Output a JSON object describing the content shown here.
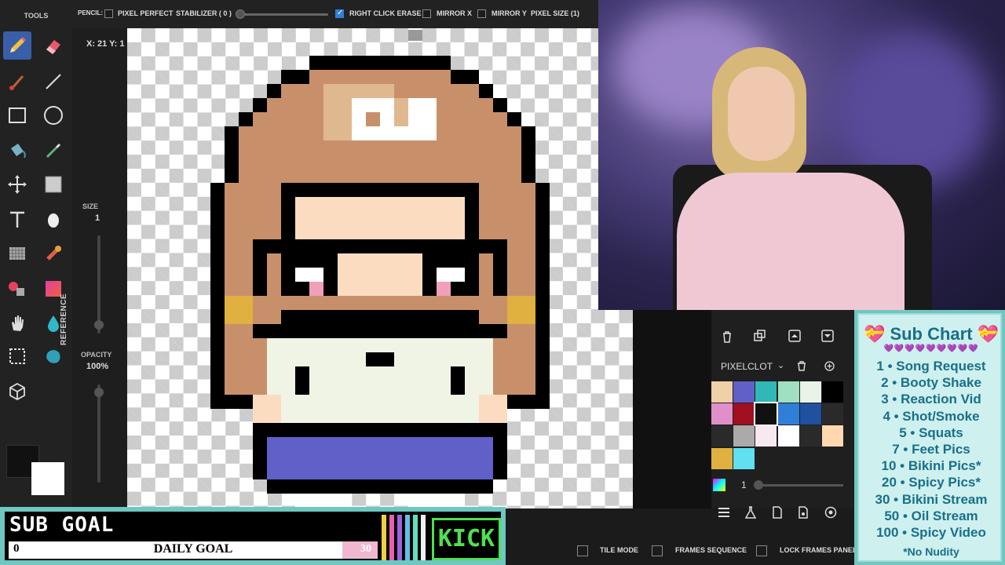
{
  "toolbar": {
    "tools_title": "TOOLS",
    "pencil_label": "PENCIL:",
    "pixel_perfect": "PIXEL PERFECT",
    "stabilizer": "STABILIZER ( 0 )",
    "right_click_erase": "RIGHT CLICK ERASE",
    "mirror_x": "MIRROR X",
    "mirror_y": "MIRROR Y",
    "pixel_size": "PIXEL SIZE (1)"
  },
  "coordinates": "X: 21 Y: 1",
  "left_panel": {
    "size_label": "SIZE",
    "size_value": "1",
    "opacity_label": "OPACITY",
    "opacity_value": "100%"
  },
  "right_panel": {
    "reference_label": "REFERENCE",
    "palette_name": "PIXELCLOT"
  },
  "palette": {
    "colors": [
      "#f0d0a8",
      "#6060c8",
      "#30b8b8",
      "#a0e0c0",
      "#e8f4e8",
      "#000000",
      "#e090c8",
      "#a01020",
      "#111111",
      "#2f7fd8",
      "#2050a0",
      "#2a2a2a",
      "#2a2a2a",
      "#aaaaaa",
      "#f8e8f0",
      "#ffffff",
      "#2a2a2a",
      "#ffd8b0",
      "#e0b040",
      "#60e0f0"
    ],
    "layers_count": "1"
  },
  "bottom_bar": {
    "tile_mode": "TILE MODE",
    "frames_sequence": "FRAMES SEQUENCE",
    "lock_frames_panel": "LOCK FRAMES PANEL"
  },
  "sub_goal": {
    "title": "SUB GOAL",
    "start": "0",
    "label": "DAILY GOAL",
    "end": "30",
    "kick": "KICK",
    "progress_percent": 10
  },
  "sub_chart": {
    "title": "💝 Sub Chart 💝",
    "hearts": "💜💜💜💜💜💜💜💜💜",
    "items": [
      "1 • Song Request",
      "2 • Booty Shake",
      "3 • Reaction Vid",
      "4 • Shot/Smoke",
      "5 • Squats",
      "7 • Feet Pics",
      "10 • Bikini Pics*",
      "20 • Spicy Pics*",
      "30 • Bikini Stream",
      "50 • Oil Stream",
      "100 • Spicy Video"
    ],
    "note": "*No Nudity"
  },
  "colors": {
    "accent": "#2f7fd8",
    "overlay_teal": "#6ec7c0",
    "kick_green": "#4fe04f"
  }
}
